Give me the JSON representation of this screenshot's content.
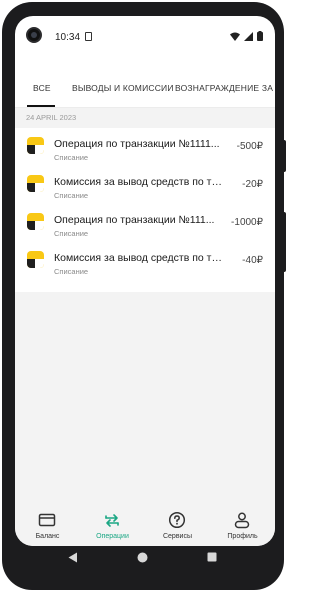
{
  "status_bar": {
    "time": "10:34"
  },
  "tabs": [
    {
      "label": "ВСЕ",
      "active": true
    },
    {
      "label": "ВЫВОДЫ И КОМИССИИ",
      "active": false
    },
    {
      "label": "ВОЗНАГРАЖДЕНИЕ ЗА ДР",
      "active": false
    }
  ],
  "date_header": "24 APRIL 2023",
  "transactions": [
    {
      "title": "Операция по транзакции №1111...",
      "subtitle": "Списание",
      "amount": "-500₽"
    },
    {
      "title": "Комиссия за вывод средств по тр...",
      "subtitle": "Списание",
      "amount": "-20₽"
    },
    {
      "title": "Операция по транзакции №111...",
      "subtitle": "Списание",
      "amount": "-1000₽"
    },
    {
      "title": "Комиссия за вывод средств по тр...",
      "subtitle": "Списание",
      "amount": "-40₽"
    }
  ],
  "bottom_nav": [
    {
      "label": "Баланс",
      "icon": "wallet-icon",
      "active": false
    },
    {
      "label": "Операции",
      "icon": "transfer-arrows-icon",
      "active": true
    },
    {
      "label": "Сервисы",
      "icon": "help-circle-icon",
      "active": false
    },
    {
      "label": "Профиль",
      "icon": "person-icon",
      "active": false
    }
  ],
  "colors": {
    "accent": "#1ba784",
    "brand_yellow": "#f9c815"
  }
}
